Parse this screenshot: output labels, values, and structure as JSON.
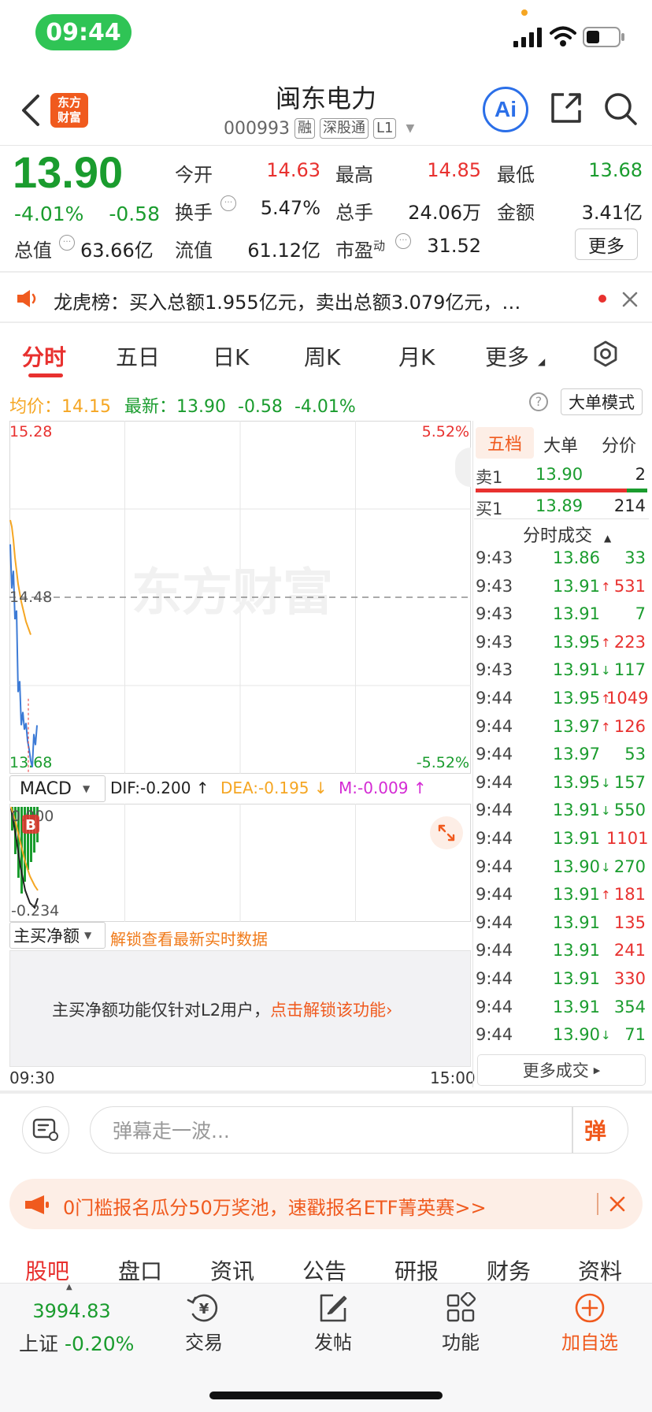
{
  "status": {
    "time": "09:44"
  },
  "header": {
    "name": "闽东电力",
    "code": "000993",
    "tags": [
      "融",
      "深股通",
      "L1"
    ],
    "logo_text": [
      "东方",
      "财富"
    ],
    "ai_label": "Ai"
  },
  "quote": {
    "price": "13.90",
    "change_pct": "-4.01%",
    "change_abs": "-0.58",
    "total_mv_label": "总值",
    "total_mv": "63.66亿",
    "fields": [
      {
        "label": "今开",
        "value": "14.63",
        "color": "red"
      },
      {
        "label": "最高",
        "value": "14.85",
        "color": "red"
      },
      {
        "label": "最低",
        "value": "13.68",
        "color": "green"
      },
      {
        "label": "换手",
        "value": "5.47%",
        "color": "dark"
      },
      {
        "label": "总手",
        "value": "24.06万",
        "color": "dark"
      },
      {
        "label": "金额",
        "value": "3.41亿",
        "color": "dark"
      },
      {
        "label": "流值",
        "value": "61.12亿",
        "color": "dark"
      },
      {
        "label": "市盈",
        "sup": "动",
        "value": "31.52",
        "color": "dark"
      }
    ],
    "more_button": "更多"
  },
  "notice": {
    "text": "龙虎榜：买入总额1.955亿元，卖出总额3.079亿元，…"
  },
  "kline_tabs": [
    "分时",
    "五日",
    "日K",
    "周K",
    "月K",
    "更多"
  ],
  "chart_info": {
    "avg_label": "均价：",
    "avg_value": "14.15",
    "latest_label": "最新：",
    "latest_value": "13.90",
    "latest_change": "-0.58",
    "latest_pct": "-4.01%",
    "mode_button": "大单模式"
  },
  "chart_data": {
    "type": "line",
    "y_top": "15.28",
    "y_mid": "14.48",
    "y_bottom": "13.68",
    "pct_top": "5.52%",
    "pct_bottom": "-5.52%",
    "x_start": "09:30",
    "x_end": "15:00",
    "ylim": [
      13.68,
      15.28
    ],
    "prev_close": 14.48,
    "series": [
      {
        "values": [
          14.72,
          14.52,
          14.6,
          14.38,
          14.42,
          14.05,
          14.1,
          13.9,
          13.96,
          13.88,
          13.91,
          13.83,
          13.79,
          13.74,
          13.71,
          13.86,
          13.81,
          13.9
        ]
      },
      {
        "values": [
          14.83,
          14.8,
          14.74,
          14.66,
          14.6,
          14.54,
          14.5,
          14.46,
          14.43,
          14.4,
          14.37,
          14.35,
          14.33,
          14.31
        ]
      }
    ],
    "watermark": "东方财富"
  },
  "macd": {
    "label": "MACD",
    "dif": "DIF:-0.200 ↑",
    "dea": "DEA:-0.195 ↓",
    "m": "M:-0.009 ↑",
    "y_top": "0.000",
    "y_bottom": "-0.234",
    "b_marker": "B"
  },
  "main_buy": {
    "label": "主买净额",
    "unlock": "解锁查看最新实时数据",
    "msg_prefix": "主买净额功能仅针对L2用户，",
    "msg_link": "点击解锁该功能"
  },
  "side": {
    "tabs": [
      "五档",
      "大单",
      "分价"
    ],
    "sell1": {
      "label": "卖1",
      "price": "13.90",
      "vol": "2"
    },
    "buy1": {
      "label": "买1",
      "price": "13.89",
      "vol": "214"
    },
    "trades_title": "分时成交",
    "trades": [
      {
        "t": "9:43",
        "p": "13.86",
        "a": "",
        "v": "33",
        "pc": "green",
        "vc": "green"
      },
      {
        "t": "9:43",
        "p": "13.91",
        "a": "↑",
        "v": "531",
        "pc": "green",
        "vc": "red"
      },
      {
        "t": "9:43",
        "p": "13.91",
        "a": "",
        "v": "7",
        "pc": "green",
        "vc": "green"
      },
      {
        "t": "9:43",
        "p": "13.95",
        "a": "↑",
        "v": "223",
        "pc": "green",
        "vc": "red"
      },
      {
        "t": "9:43",
        "p": "13.91",
        "a": "↓",
        "v": "117",
        "pc": "green",
        "vc": "green"
      },
      {
        "t": "9:44",
        "p": "13.95",
        "a": "↑",
        "v": "1049",
        "pc": "green",
        "vc": "red"
      },
      {
        "t": "9:44",
        "p": "13.97",
        "a": "↑",
        "v": "126",
        "pc": "green",
        "vc": "red"
      },
      {
        "t": "9:44",
        "p": "13.97",
        "a": "",
        "v": "53",
        "pc": "green",
        "vc": "green"
      },
      {
        "t": "9:44",
        "p": "13.95",
        "a": "↓",
        "v": "157",
        "pc": "green",
        "vc": "green"
      },
      {
        "t": "9:44",
        "p": "13.91",
        "a": "↓",
        "v": "550",
        "pc": "green",
        "vc": "green"
      },
      {
        "t": "9:44",
        "p": "13.91",
        "a": "",
        "v": "1101",
        "pc": "green",
        "vc": "red"
      },
      {
        "t": "9:44",
        "p": "13.90",
        "a": "↓",
        "v": "270",
        "pc": "green",
        "vc": "green"
      },
      {
        "t": "9:44",
        "p": "13.91",
        "a": "↑",
        "v": "181",
        "pc": "green",
        "vc": "red"
      },
      {
        "t": "9:44",
        "p": "13.91",
        "a": "",
        "v": "135",
        "pc": "green",
        "vc": "red"
      },
      {
        "t": "9:44",
        "p": "13.91",
        "a": "",
        "v": "241",
        "pc": "green",
        "vc": "red"
      },
      {
        "t": "9:44",
        "p": "13.91",
        "a": "",
        "v": "330",
        "pc": "green",
        "vc": "red"
      },
      {
        "t": "9:44",
        "p": "13.91",
        "a": "",
        "v": "354",
        "pc": "green",
        "vc": "green"
      },
      {
        "t": "9:44",
        "p": "13.90",
        "a": "↓",
        "v": "71",
        "pc": "green",
        "vc": "green"
      }
    ],
    "more_trades": "更多成交"
  },
  "comment": {
    "placeholder": "弹幕走一波...",
    "danmu_btn": "弹"
  },
  "promo": {
    "text": "0门槛报名瓜分50万奖池，速戳报名ETF菁英赛>>"
  },
  "bottom_tabs": [
    "股吧",
    "盘口",
    "资讯",
    "公告",
    "研报",
    "财务",
    "资料"
  ],
  "nav": {
    "index_value": "3994.83",
    "index_name": "上证",
    "index_pct": "-0.20%",
    "items": [
      "交易",
      "发帖",
      "功能",
      "加自选"
    ]
  },
  "colors": {
    "red": "#e8312f",
    "green": "#1a9c2e",
    "orange": "#f07a19",
    "blue": "#3d7bd6",
    "avg": "#f5a623"
  }
}
